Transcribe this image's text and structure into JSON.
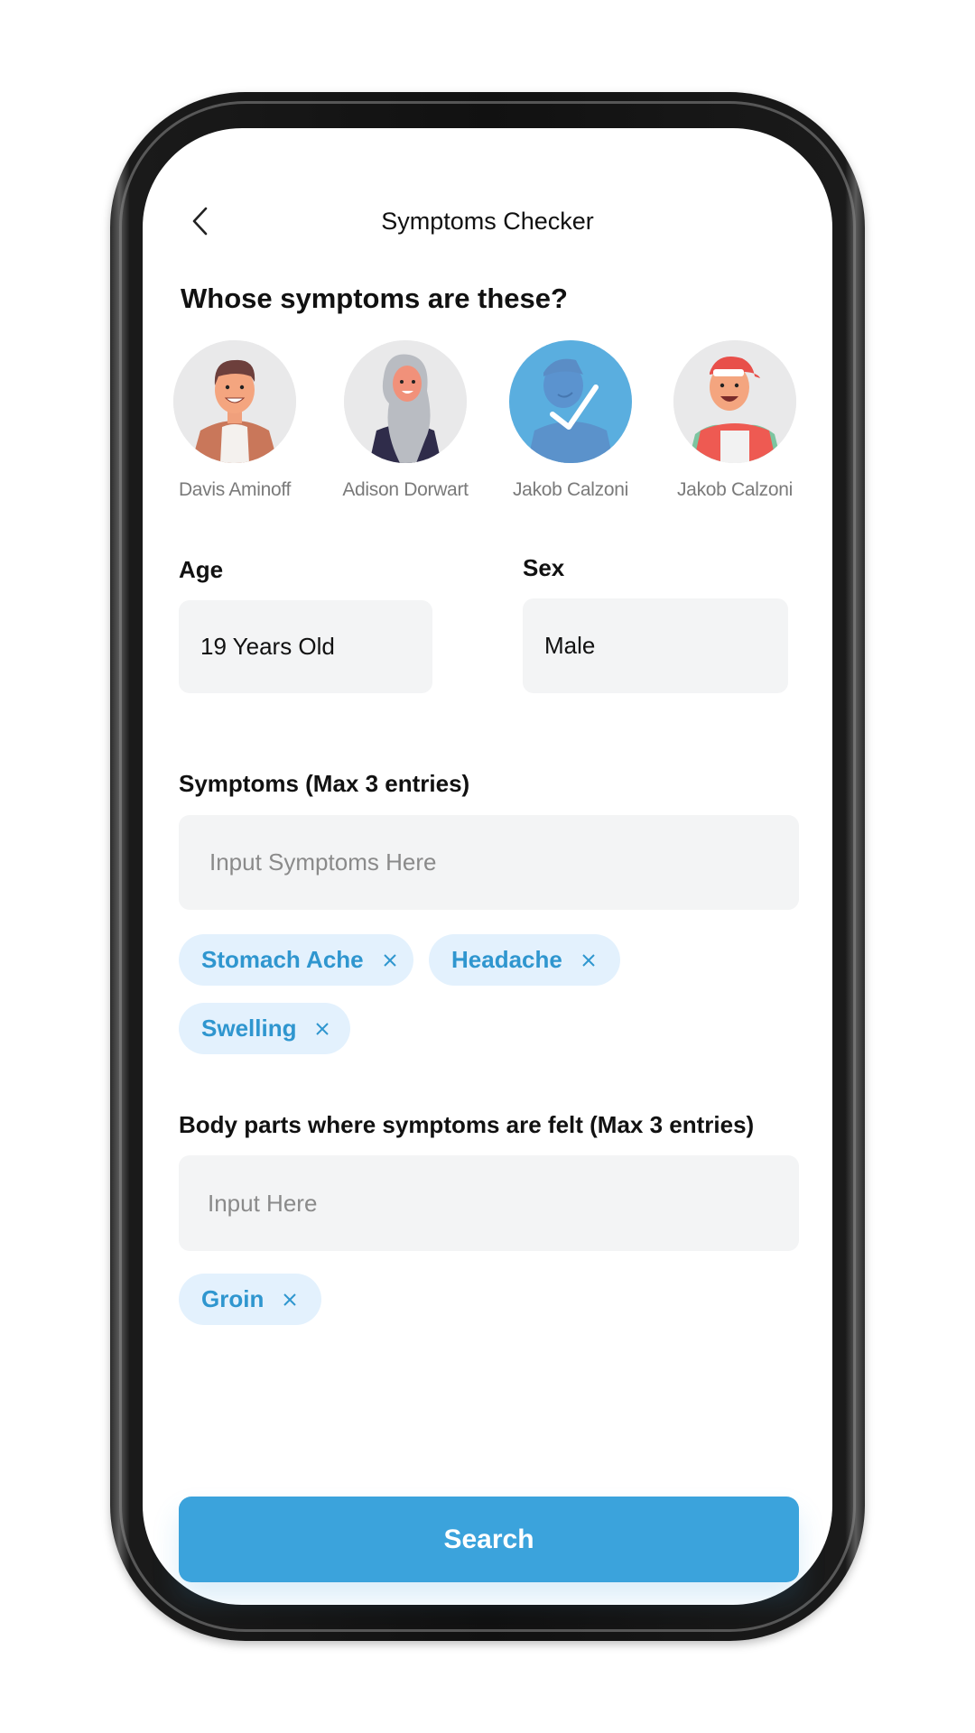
{
  "header": {
    "title": "Symptoms Checker",
    "back_icon": "chevron-left-icon"
  },
  "profiles": {
    "question": "Whose symptoms are these?",
    "items": [
      {
        "name": "Davis Aminoff",
        "selected": false
      },
      {
        "name": "Adison Dorwart",
        "selected": false
      },
      {
        "name": "Jakob Calzoni",
        "selected": true
      },
      {
        "name": "Jakob Calzoni",
        "selected": false
      }
    ],
    "selected_icon": "checkmark-icon"
  },
  "age": {
    "label": "Age",
    "value": "19 Years Old"
  },
  "sex": {
    "label": "Sex",
    "value": "Male"
  },
  "symptoms": {
    "label": "Symptoms (Max 3 entries)",
    "placeholder": "Input Symptoms Here",
    "tags": [
      "Stomach Ache",
      "Headache",
      "Swelling"
    ],
    "remove_icon": "close-icon"
  },
  "body_parts": {
    "label": "Body parts where symptoms are felt (Max 3 entries)",
    "placeholder": "Input Here",
    "tags": [
      "Groin"
    ],
    "remove_icon": "close-icon"
  },
  "search_button": {
    "label": "Search"
  },
  "colors": {
    "accent": "#3ba3dc",
    "chip_bg": "#e3f1fd",
    "chip_text": "#2f96cf",
    "field_bg": "#f3f4f5",
    "selected_overlay": "#4aa8de"
  }
}
